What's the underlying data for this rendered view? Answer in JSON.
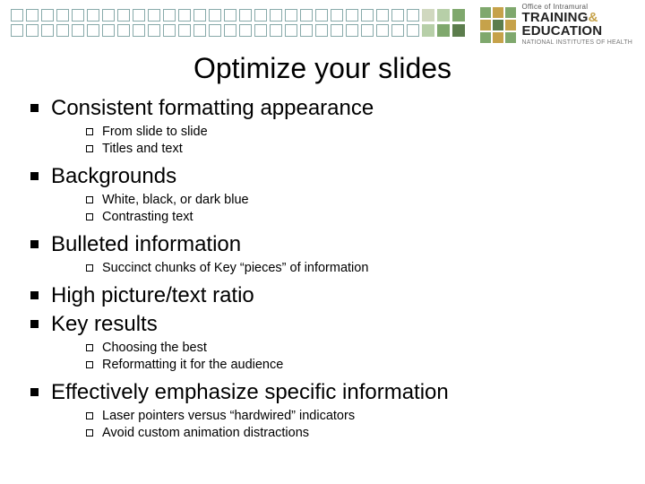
{
  "logo": {
    "top": "Office of Intramural",
    "line1": "TRAINING",
    "amp": "&",
    "line2": "EDUCATION",
    "bottom": "NATIONAL INSTITUTES OF HEALTH"
  },
  "title": "Optimize your slides",
  "items": [
    {
      "text": "Consistent formatting appearance",
      "subs": [
        "From slide to slide",
        "Titles and text"
      ]
    },
    {
      "text": "Backgrounds",
      "subs": [
        "White, black, or dark blue",
        "Contrasting text"
      ]
    },
    {
      "text": "Bulleted information",
      "subs": [
        "Succinct chunks of Key “pieces” of information"
      ]
    },
    {
      "text": "High picture/text ratio",
      "subs": []
    },
    {
      "text": "Key results",
      "subs": [
        "Choosing the best",
        "Reformatting it for the audience"
      ]
    },
    {
      "text": "Effectively emphasize specific information",
      "subs": [
        "Laser pointers versus “hardwired” indicators",
        "Avoid custom animation distractions"
      ]
    }
  ]
}
